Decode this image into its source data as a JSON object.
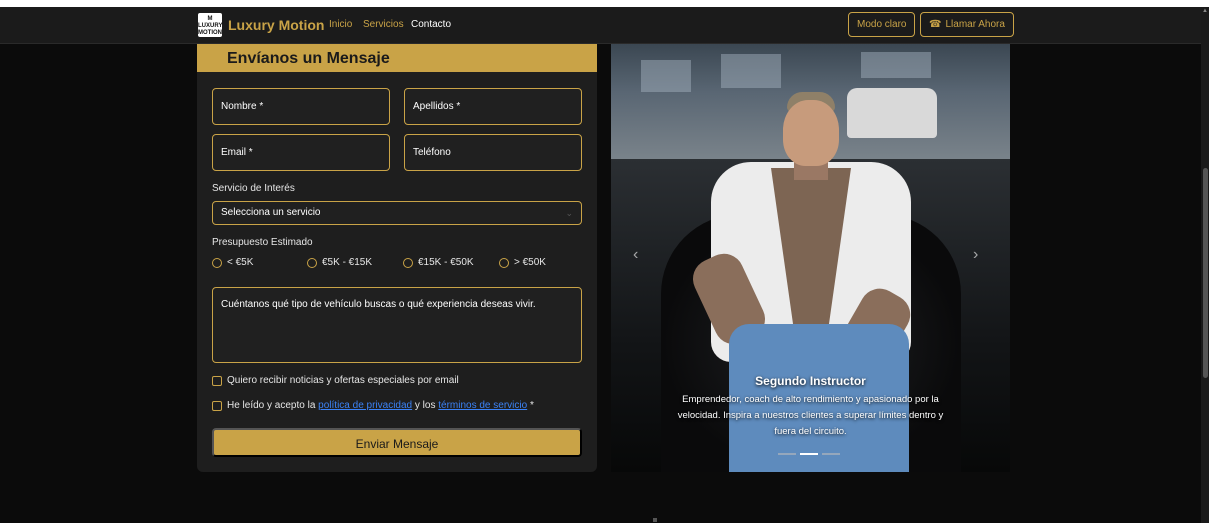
{
  "nav": {
    "logo_text": "M LUXURY MOTION",
    "brand": "Luxury Motion",
    "links": [
      "Inicio",
      "Servicios",
      "Contacto"
    ],
    "mode_button": "Modo claro",
    "call_button": "Llamar Ahora"
  },
  "form": {
    "title": "Envíanos un Mensaje",
    "fields": {
      "nombre": "Nombre *",
      "apellidos": "Apellidos *",
      "email": "Email *",
      "telefono": "Teléfono"
    },
    "service_label": "Servicio de Interés",
    "service_value": "Selecciona un servicio",
    "budget_label": "Presupuesto Estimado",
    "budget_options": [
      "< €5K",
      "€5K - €15K",
      "€15K - €50K",
      "> €50K"
    ],
    "message_label": "Cuéntanos",
    "message_placeholder": "Cuéntanos qué tipo de vehículo buscas o qué experiencia deseas vivir.",
    "newsletter": "Quiero recibir noticias y ofertas especiales por email",
    "terms_prefix": "He leído y acepto la",
    "privacy_link": "política de privacidad",
    "terms_mid": "y los",
    "terms_link": "términos de servicio",
    "terms_suffix": "*",
    "submit": "Enviar Mensaje"
  },
  "carousel": {
    "title": "Segundo Instructor",
    "text": "Emprendedor, coach de alto rendimiento y apasionado por la velocidad. Inspira a nuestros clientes a superar límites dentro y fuera del circuito.",
    "slides": 3,
    "active_index": 1
  },
  "colors": {
    "accent": "#c9a347",
    "background": "#0b0b0b",
    "panel": "#1e1e1e"
  }
}
